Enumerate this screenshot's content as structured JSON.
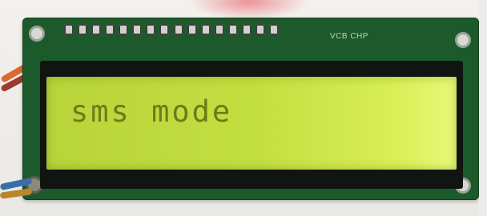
{
  "lcd": {
    "line1": "sms mode",
    "backlight_color": "#c3de3f",
    "text_color": "#6f7a18"
  },
  "board": {
    "marking": "VCB CHP",
    "pcb_color": "#1d5a2b",
    "pin_count": 16
  }
}
